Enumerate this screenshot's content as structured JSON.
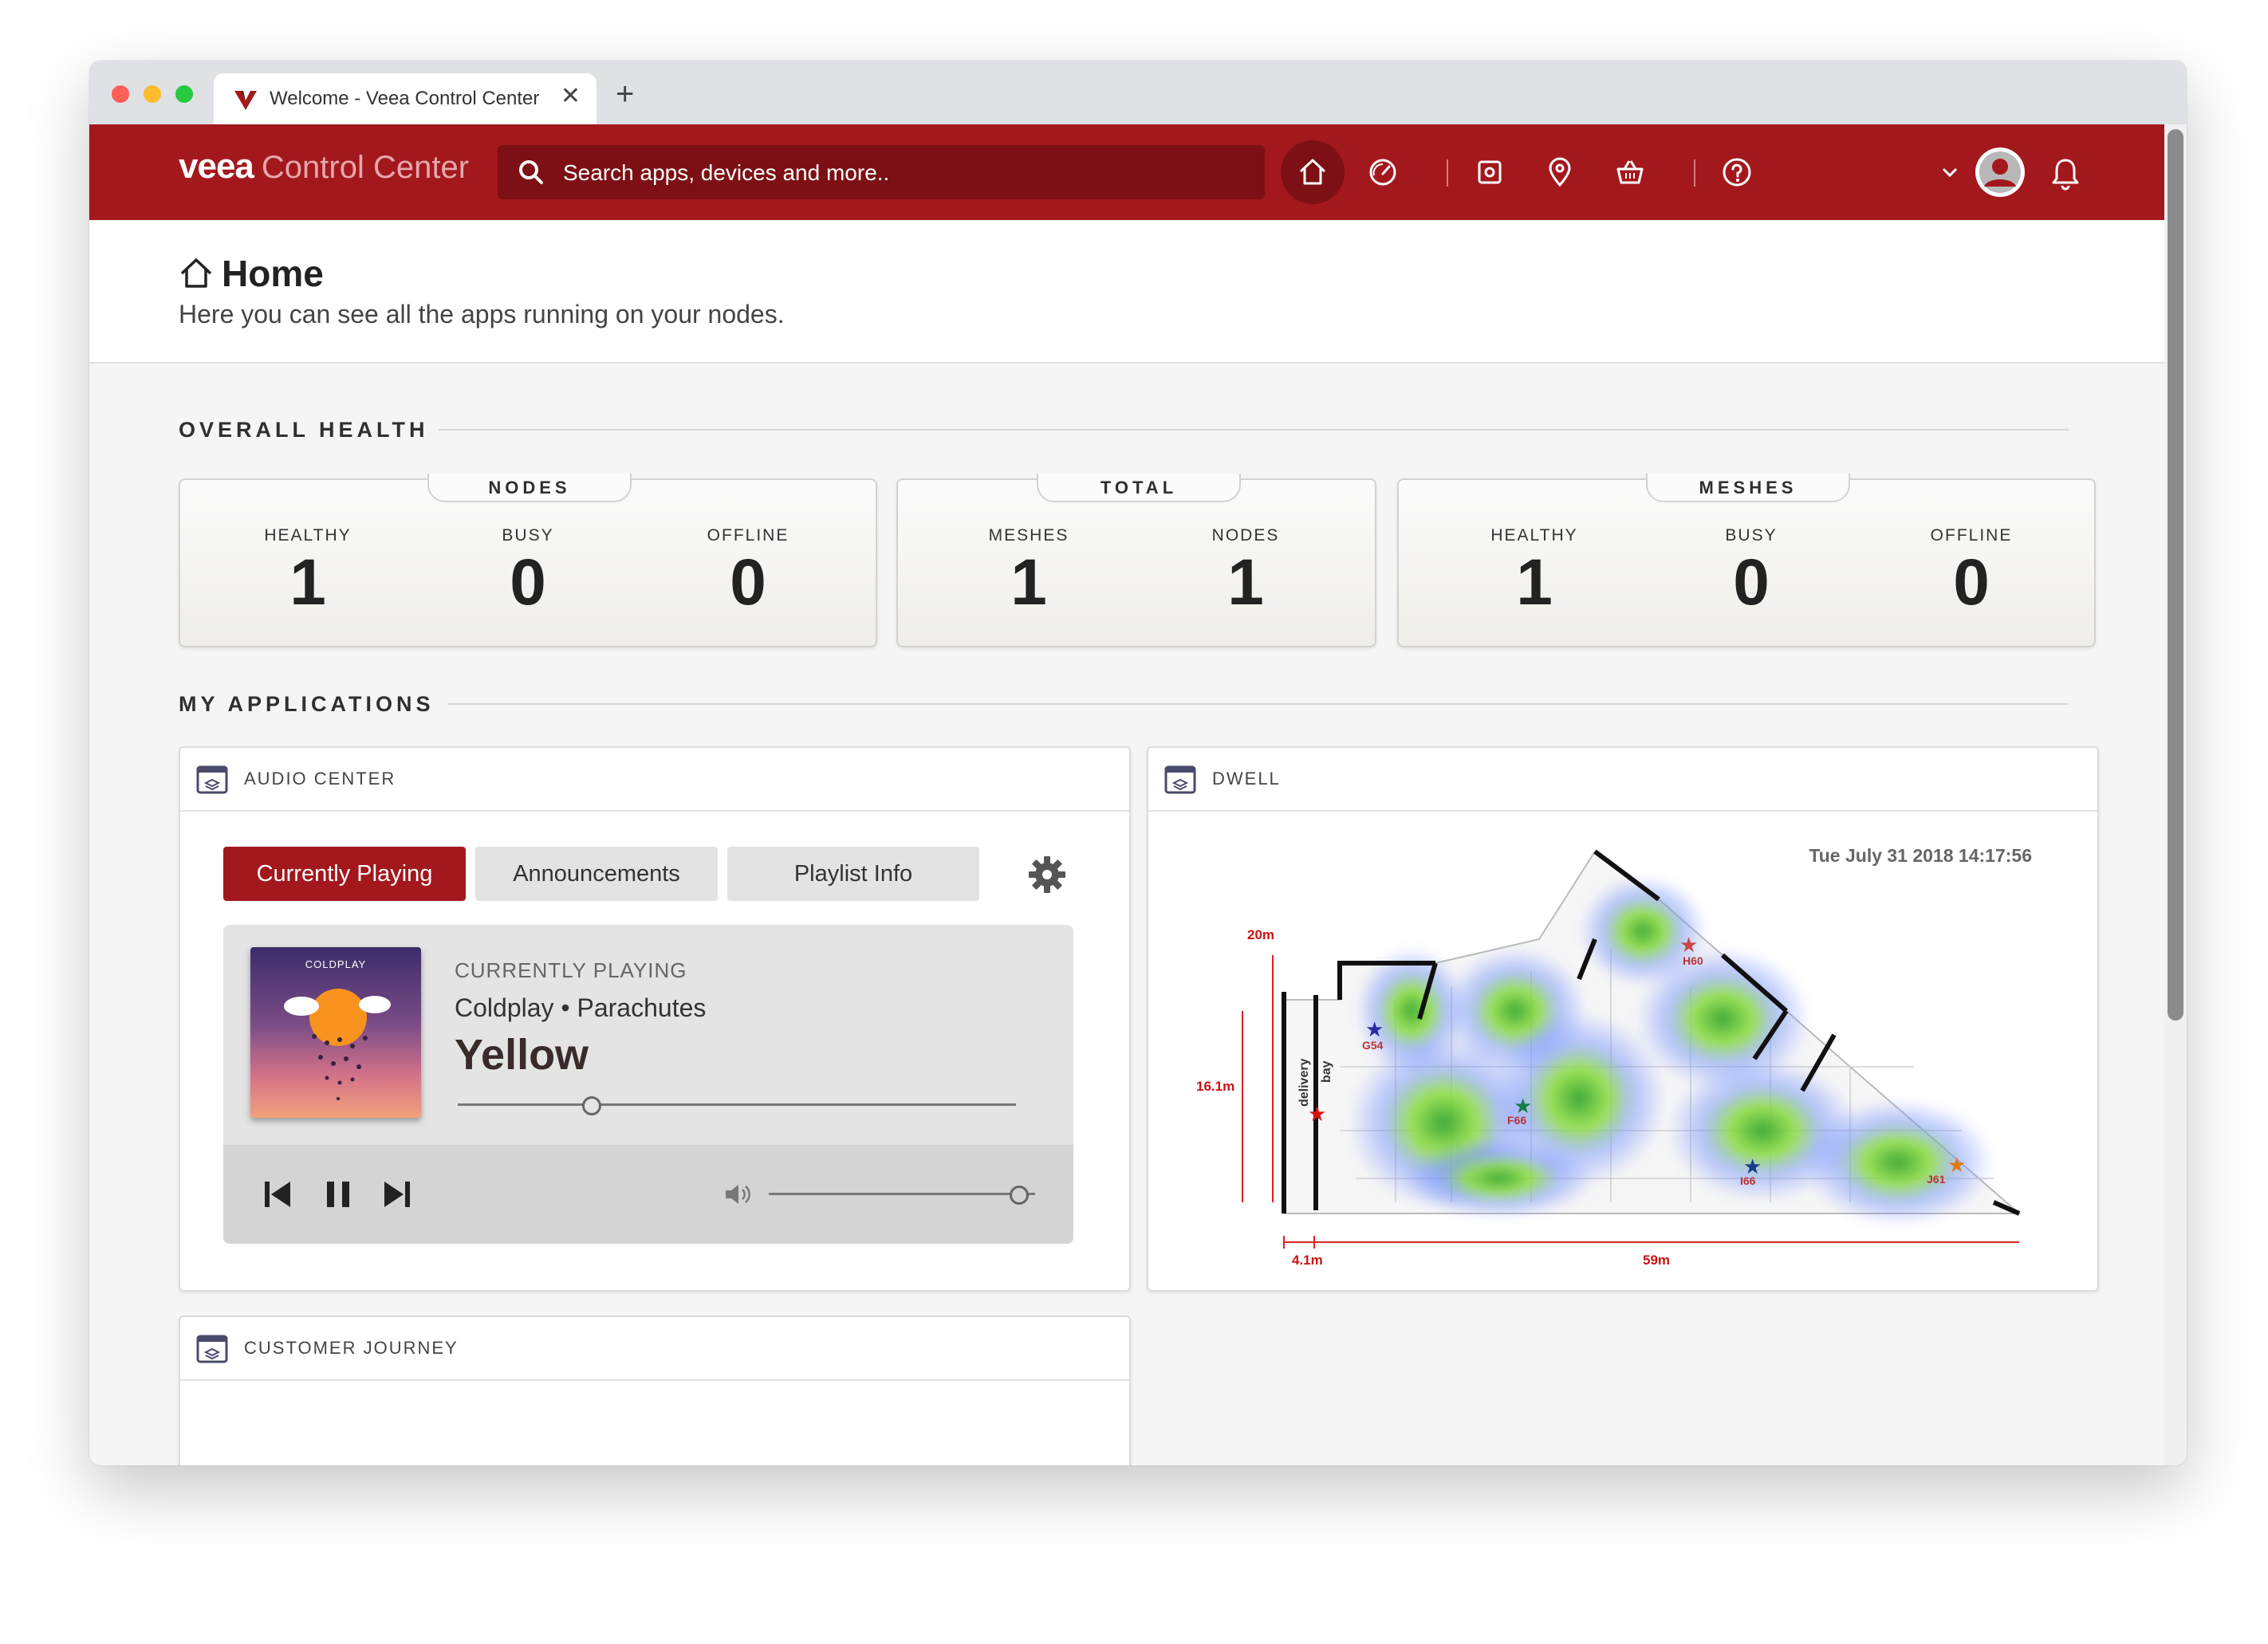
{
  "browser": {
    "tab_title": "Welcome - Veea Control Center",
    "tab_close": "✕",
    "new_tab": "+",
    "traffic_lights": [
      "#fe5f57",
      "#febc2e",
      "#28c840"
    ]
  },
  "header": {
    "brand_bold": "veea",
    "brand_light": "Control Center",
    "search_placeholder": "Search apps, devices and more..",
    "icons": [
      "home-icon",
      "dashboard-gauge-icon",
      "device-icon",
      "location-pin-icon",
      "basket-icon",
      "help-icon",
      "chevron-down-icon",
      "user-avatar-icon",
      "bell-icon"
    ],
    "color": "#a3181d"
  },
  "page": {
    "title": "Home",
    "subtitle": "Here you can see all the apps running on your nodes."
  },
  "overall_health": {
    "label": "OVERALL HEALTH",
    "cards": [
      {
        "title": "NODES",
        "stats": [
          {
            "label": "HEALTHY",
            "value": "1"
          },
          {
            "label": "BUSY",
            "value": "0"
          },
          {
            "label": "OFFLINE",
            "value": "0"
          }
        ]
      },
      {
        "title": "TOTAL",
        "stats": [
          {
            "label": "MESHES",
            "value": "1"
          },
          {
            "label": "NODES",
            "value": "1"
          }
        ]
      },
      {
        "title": "MESHES",
        "stats": [
          {
            "label": "HEALTHY",
            "value": "1"
          },
          {
            "label": "BUSY",
            "value": "0"
          },
          {
            "label": "OFFLINE",
            "value": "0"
          }
        ]
      }
    ]
  },
  "my_applications": {
    "label": "MY APPLICATIONS",
    "audio_center": {
      "title": "AUDIO CENTER",
      "tabs": [
        "Currently Playing",
        "Announcements",
        "Playlist Info"
      ],
      "cover_text": "COLDPLAY",
      "now_playing_label": "CURRENTLY PLAYING",
      "artist_album": "Coldplay • Parachutes",
      "song": "Yellow",
      "progress": 0.24,
      "volume": 0.94
    },
    "dwell": {
      "title": "DWELL",
      "timestamp": "Tue July 31 2018 14:17:56",
      "dims": [
        "20m",
        "16.1m",
        "delivery",
        "bay",
        "4.1m",
        "59m"
      ],
      "markers": [
        "G54",
        "F66",
        "I66",
        "H60",
        "J61"
      ]
    },
    "customer_journey": {
      "title": "CUSTOMER JOURNEY"
    }
  }
}
